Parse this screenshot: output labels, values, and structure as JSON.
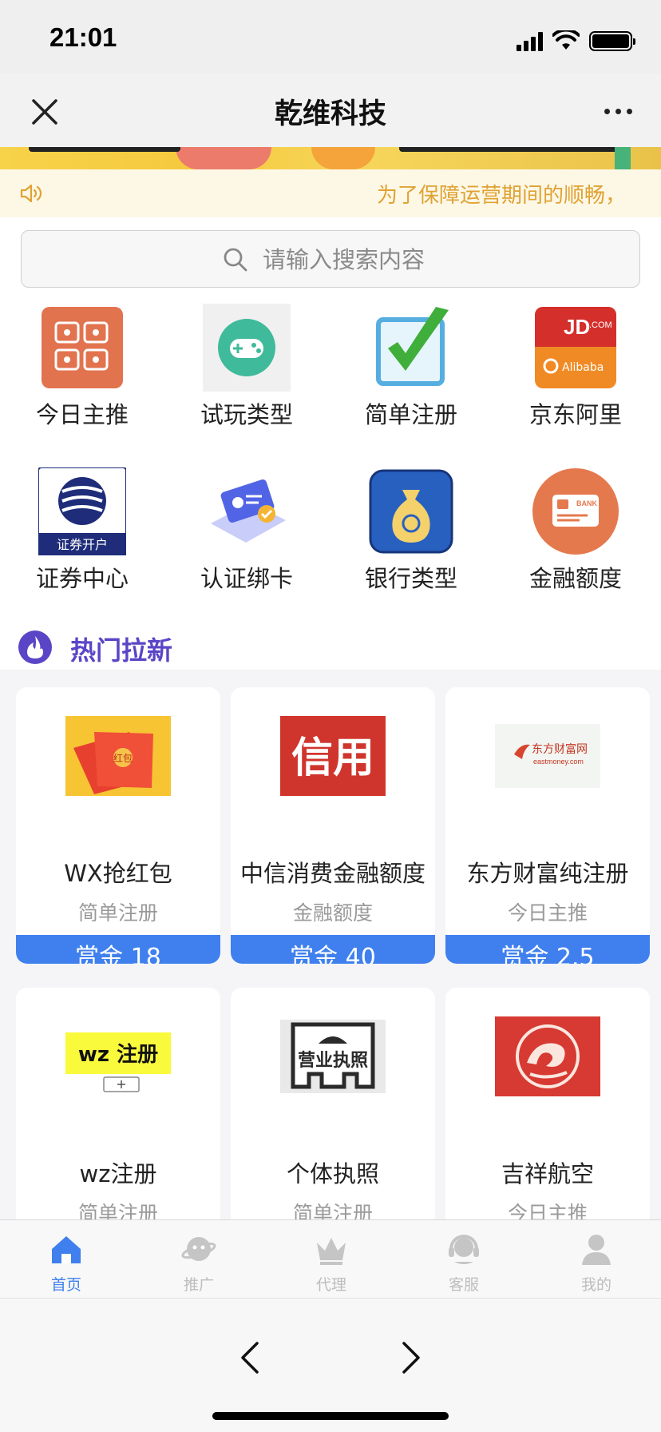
{
  "status": {
    "time": "21:01"
  },
  "nav": {
    "title": "乾维科技"
  },
  "notice": {
    "text": "为了保障运营期间的顺畅，"
  },
  "search": {
    "placeholder": "请输入搜索内容"
  },
  "categories": [
    {
      "label": "今日主推",
      "icon": "recommend-grid-icon"
    },
    {
      "label": "试玩类型",
      "icon": "gamepad-icon"
    },
    {
      "label": "简单注册",
      "icon": "checkmark-icon"
    },
    {
      "label": "京东阿里",
      "icon": "jd-alibaba-logo"
    },
    {
      "label": "证券中心",
      "icon": "securities-logo",
      "badge": "证券开户"
    },
    {
      "label": "认证绑卡",
      "icon": "id-card-icon"
    },
    {
      "label": "银行类型",
      "icon": "money-bag-icon"
    },
    {
      "label": "金融额度",
      "icon": "bank-card-icon",
      "badge": "BANK"
    }
  ],
  "hot": {
    "title": "热门拉新"
  },
  "products": [
    {
      "name": "WX抢红包",
      "type": "简单注册",
      "reward": "赏金 18",
      "img": "red-envelope",
      "img_text": "红包"
    },
    {
      "name": "中信消费金融额度",
      "type": "金融额度",
      "reward": "赏金 40",
      "img": "xinyong-logo",
      "img_text": "信用"
    },
    {
      "name": "东方财富纯注册",
      "type": "今日主推",
      "reward": "赏金 2.5",
      "img": "eastmoney-logo",
      "img_text": "东方财富网",
      "img_sub": "eastmoney.com"
    },
    {
      "name": "wz注册",
      "type": "简单注册",
      "reward": "",
      "img": "wz-register",
      "img_text": "wz 注册"
    },
    {
      "name": "个体执照",
      "type": "简单注册",
      "reward": "",
      "img": "business-license",
      "img_text": "营业执照"
    },
    {
      "name": "吉祥航空",
      "type": "今日主推",
      "reward": "",
      "img": "juneyao-logo"
    }
  ],
  "tabs": [
    {
      "label": "首页",
      "icon": "home-icon",
      "active": true
    },
    {
      "label": "推广",
      "icon": "planet-icon",
      "active": false
    },
    {
      "label": "代理",
      "icon": "crown-icon",
      "active": false
    },
    {
      "label": "客服",
      "icon": "headset-icon",
      "active": false
    },
    {
      "label": "我的",
      "icon": "user-icon",
      "active": false
    }
  ],
  "colors": {
    "accent": "#3f80ee",
    "hot": "#5a45c7",
    "notice": "#e0a233"
  }
}
